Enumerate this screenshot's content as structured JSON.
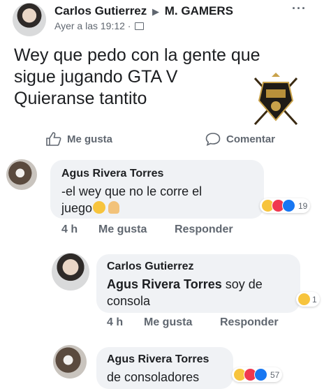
{
  "post": {
    "author": "Carlos Gutierrez",
    "arrow": "▶",
    "group": "M. GAMERS",
    "timestamp": "Ayer a las 19:12 ·",
    "menu": "···",
    "text_line1": "Wey que pedo con la gente que",
    "text_line2": "sigue jugando GTA V",
    "text_line3": "Quieranse tantito",
    "like_label": "Me gusta",
    "comment_label": "Comentar"
  },
  "comments": [
    {
      "name": "Agus Rivera Torres",
      "line1": "-el wey que no le corre el",
      "line2": "juego",
      "time": "4 h",
      "like": "Me gusta",
      "reply": "Responder",
      "reaction_count": "19"
    },
    {
      "name": "Carlos Gutierrez",
      "tag": "Agus Rivera Torres",
      "line1_rest": " soy de",
      "line2": "consola",
      "time": "4 h",
      "like": "Me gusta",
      "reply": "Responder",
      "reaction_count": "1"
    },
    {
      "name": "Agus Rivera Torres",
      "line1": "de consoladores",
      "reaction_count": "57"
    }
  ],
  "colors": {
    "bubble": "#f0f2f5",
    "meta_text": "#606770",
    "like_blue": "#1877f2",
    "love_red": "#f0384f",
    "haha_yellow": "#f7c43d"
  }
}
